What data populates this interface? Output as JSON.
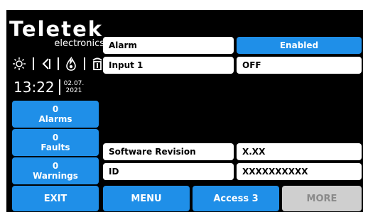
{
  "logo": {
    "brand": "Teletek",
    "sub": "electronics"
  },
  "status_icons": [
    "sun-icon",
    "speaker-icon",
    "flame-icon",
    "phone-icon"
  ],
  "clock": {
    "time": "13:22",
    "date_line1": "02.07.",
    "date_line2": "2021"
  },
  "side_buttons": [
    {
      "count": "0",
      "label": "Alarms"
    },
    {
      "count": "0",
      "label": "Faults"
    },
    {
      "count": "0",
      "label": "Warnings"
    }
  ],
  "rows": [
    {
      "label": "Alarm",
      "value": "Enabled"
    },
    {
      "label": "Input 1",
      "value": "OFF"
    },
    {
      "label": "Software Revision",
      "value": "X.XX"
    },
    {
      "label": "ID",
      "value": "XXXXXXXXXX"
    }
  ],
  "bottom_buttons": [
    {
      "label": "EXIT",
      "enabled": true
    },
    {
      "label": "MENU",
      "enabled": true
    },
    {
      "label": "Access 3",
      "enabled": true
    },
    {
      "label": "MORE",
      "enabled": false
    }
  ],
  "colors": {
    "accent": "#1f8fe8",
    "background": "#000000",
    "disabled": "#cfcfcf"
  }
}
